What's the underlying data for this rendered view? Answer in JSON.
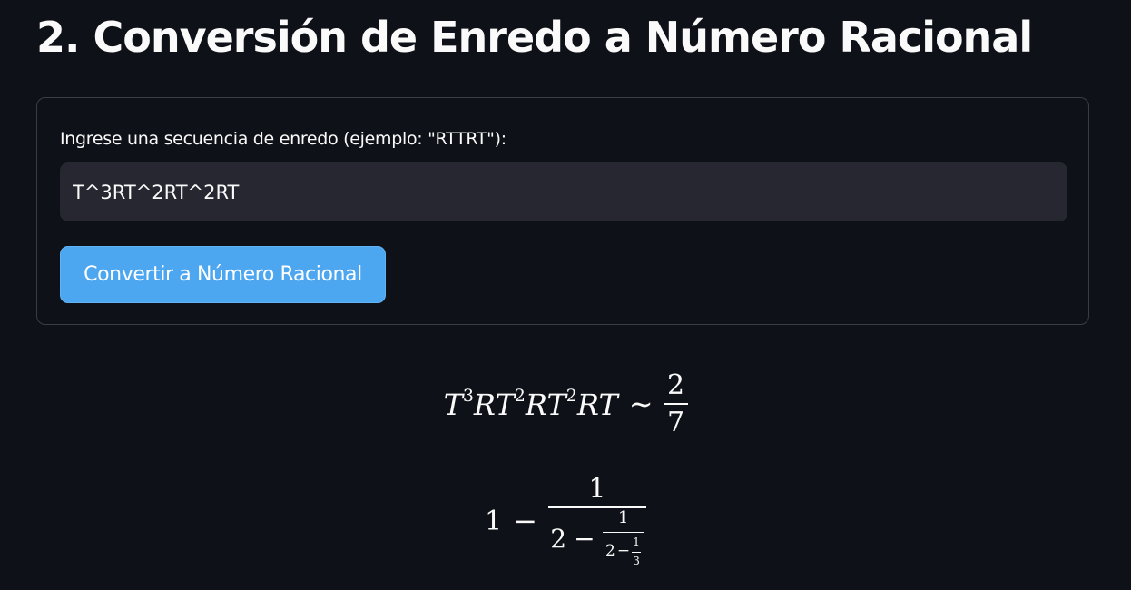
{
  "page": {
    "title": "2. Conversión de Enredo a Número Racional"
  },
  "form": {
    "input_label": "Ingrese una secuencia de enredo (ejemplo: \"RTTRT\"):",
    "input_value": "T^3RT^2RT^2RT",
    "button_label": "Convertir a Número Racional"
  },
  "result": {
    "sequence_terms": [
      {
        "base": "T",
        "exp": "3"
      },
      {
        "base": "R",
        "exp": ""
      },
      {
        "base": "T",
        "exp": "2"
      },
      {
        "base": "R",
        "exp": ""
      },
      {
        "base": "T",
        "exp": "2"
      },
      {
        "base": "R",
        "exp": ""
      },
      {
        "base": "T",
        "exp": ""
      }
    ],
    "relation_symbol": "∼",
    "fraction": {
      "numerator": "2",
      "denominator": "7"
    },
    "continued_fraction": {
      "lead": "1",
      "minus": "−",
      "level1": {
        "numerator": "1",
        "whole": "2"
      },
      "level2": {
        "numerator": "1",
        "whole": "2"
      },
      "level3": {
        "numerator": "1",
        "denominator": "3"
      }
    }
  },
  "colors": {
    "background": "#0e1117",
    "text": "#fafafa",
    "input_background": "#262730",
    "button": "#4da6f0",
    "border": "#3a3d45"
  }
}
